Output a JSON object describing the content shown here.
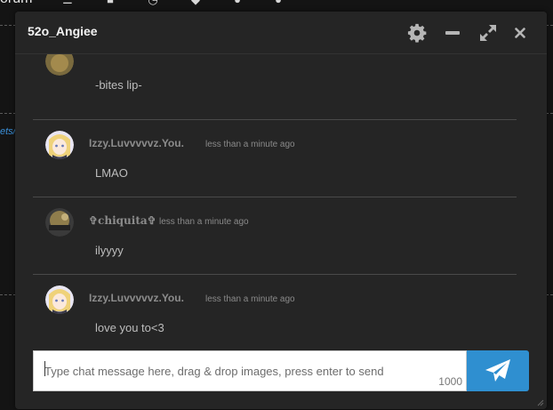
{
  "background": {
    "forum_text": "orum",
    "link_fragment": "ets/"
  },
  "chat": {
    "title": "52o_Angiee",
    "header_buttons": [
      "gear-icon",
      "minimize-icon",
      "expand-icon",
      "close-icon"
    ],
    "messages": [
      {
        "username": "",
        "timestamp": "",
        "text": "-bites lip-",
        "avatar": "avatar-gold"
      },
      {
        "username": "Izzy.Luvvvvvz.You.",
        "timestamp": "less than a minute ago",
        "text": "LMAO",
        "avatar": "avatar-anime-blonde"
      },
      {
        "username": "✞chiquita✞",
        "timestamp": "less than a minute ago",
        "text": "ilyyyy",
        "avatar": "avatar-gold-photo"
      },
      {
        "username": "Izzy.Luvvvvvz.You.",
        "timestamp": "less than a minute ago",
        "text": "love you to<3",
        "avatar": "avatar-anime-blonde"
      }
    ],
    "input": {
      "placeholder": "Type chat message here, drag & drop images, press enter to send",
      "value": "",
      "char_limit": "1000"
    },
    "send_icon": "paper-plane-icon"
  },
  "colors": {
    "accent": "#2f8fd0",
    "window_bg": "#252525",
    "page_bg": "#141414"
  }
}
